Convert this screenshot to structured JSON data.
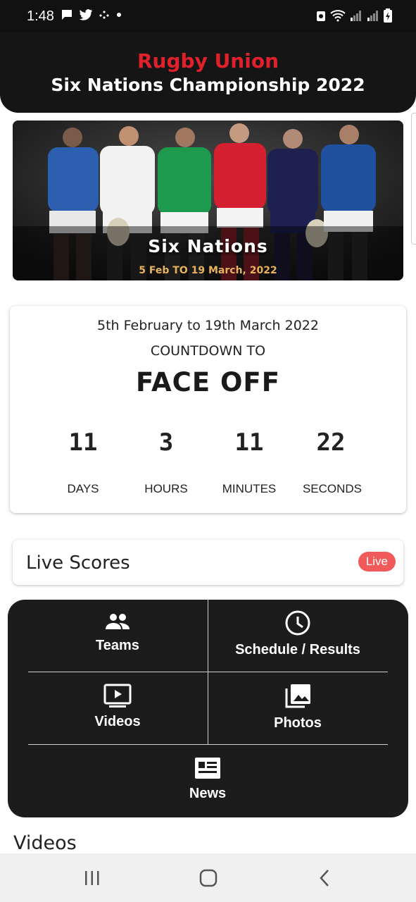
{
  "status_bar": {
    "time": "1:48",
    "notification_icons": [
      "chat-icon",
      "twitter-icon",
      "binance-icon",
      "dot-icon"
    ],
    "system_icons": [
      "recycle-icon",
      "wifi-icon",
      "signal-icon",
      "signal-icon",
      "battery-icon"
    ]
  },
  "header": {
    "sport": "Rugby Union",
    "title": "Six Nations Championship 2022",
    "accent_color": "#e0202a"
  },
  "banner": {
    "title": "Six Nations",
    "dates": "5 Feb TO 19 March, 2022",
    "date_color": "#e8b25a"
  },
  "countdown": {
    "date_range": "5th February to 19th March 2022",
    "label": "COUNTDOWN TO",
    "event": "FACE OFF",
    "units": [
      {
        "value": "11",
        "label": "DAYS"
      },
      {
        "value": "3",
        "label": "HOURS"
      },
      {
        "value": "11",
        "label": "MINUTES"
      },
      {
        "value": "22",
        "label": "SECONDS"
      }
    ]
  },
  "live_scores": {
    "title": "Live Scores",
    "badge": "Live",
    "badge_color": "#f05a5a"
  },
  "menu": {
    "items": [
      {
        "label": "Teams",
        "icon": "people-icon"
      },
      {
        "label": "Schedule / Results",
        "icon": "clock-icon"
      },
      {
        "label": "Videos",
        "icon": "video-icon"
      },
      {
        "label": "Photos",
        "icon": "photos-icon"
      },
      {
        "label": "News",
        "icon": "news-icon"
      }
    ]
  },
  "sections": {
    "videos_heading": "Videos"
  },
  "nav_bar": {
    "buttons": [
      "recents-icon",
      "home-icon",
      "back-icon"
    ]
  }
}
